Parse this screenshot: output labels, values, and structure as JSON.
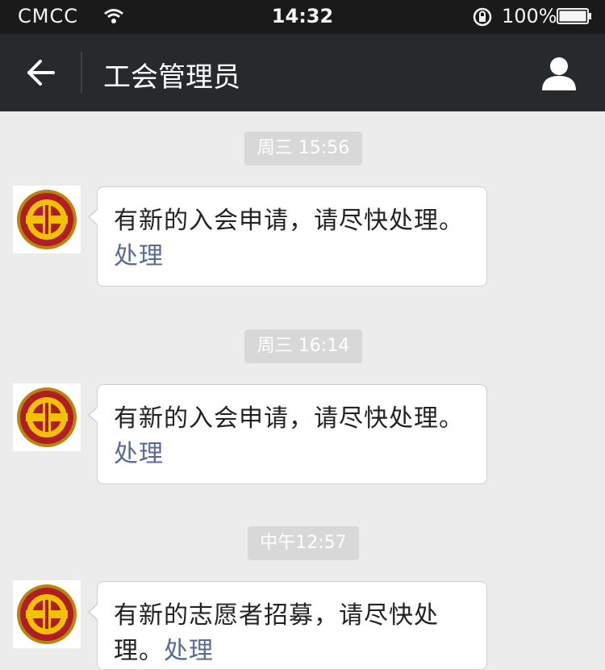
{
  "status_bar": {
    "carrier": "CMCC",
    "time": "14:32",
    "battery": "100%"
  },
  "nav": {
    "title": "工会管理员"
  },
  "messages": [
    {
      "timestamp": "周三 15:56",
      "text": "有新的入会申请，请尽快处理。",
      "link": "处理"
    },
    {
      "timestamp": "周三 16:14",
      "text": "有新的入会申请，请尽快处理。",
      "link": "处理"
    },
    {
      "timestamp": "中午12:57",
      "text": "有新的志愿者招募，请尽快处理。",
      "link": "处理"
    }
  ],
  "icons": {
    "back": "back-arrow-icon",
    "profile": "profile-icon",
    "avatar": "union-logo-icon"
  },
  "colors": {
    "nav_bg": "#262a2d",
    "link": "#576b95",
    "chat_bg": "#ececec"
  }
}
